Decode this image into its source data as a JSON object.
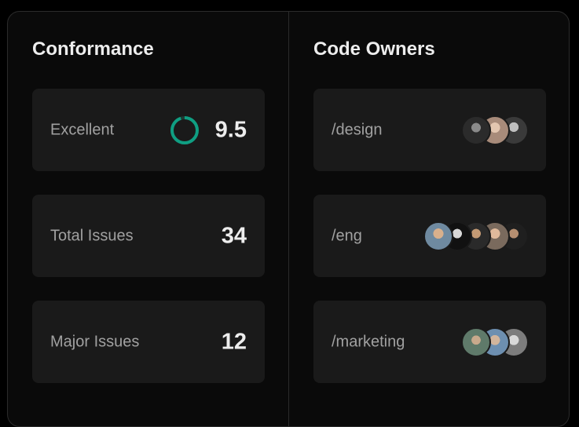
{
  "conformance": {
    "heading": "Conformance",
    "cards": [
      {
        "label": "Excellent",
        "value": "9.5",
        "ring_color": "#0f9e82",
        "ring_track": "#1f3b34"
      },
      {
        "label": "Total Issues",
        "value": "34"
      },
      {
        "label": "Major Issues",
        "value": "12"
      }
    ]
  },
  "code_owners": {
    "heading": "Code Owners",
    "teams": [
      {
        "label": "/design",
        "avatars": [
          "avatar",
          "avatar",
          "avatar"
        ]
      },
      {
        "label": "/eng",
        "avatars": [
          "avatar",
          "avatar",
          "avatar",
          "avatar",
          "avatar"
        ]
      },
      {
        "label": "/marketing",
        "avatars": [
          "avatar",
          "avatar",
          "avatar"
        ]
      }
    ]
  },
  "colors": {
    "background": "#000000",
    "panel": "#0a0a0a",
    "card": "#1a1a1a",
    "border": "#2b2b2b",
    "accent_green": "#0f9e82"
  }
}
